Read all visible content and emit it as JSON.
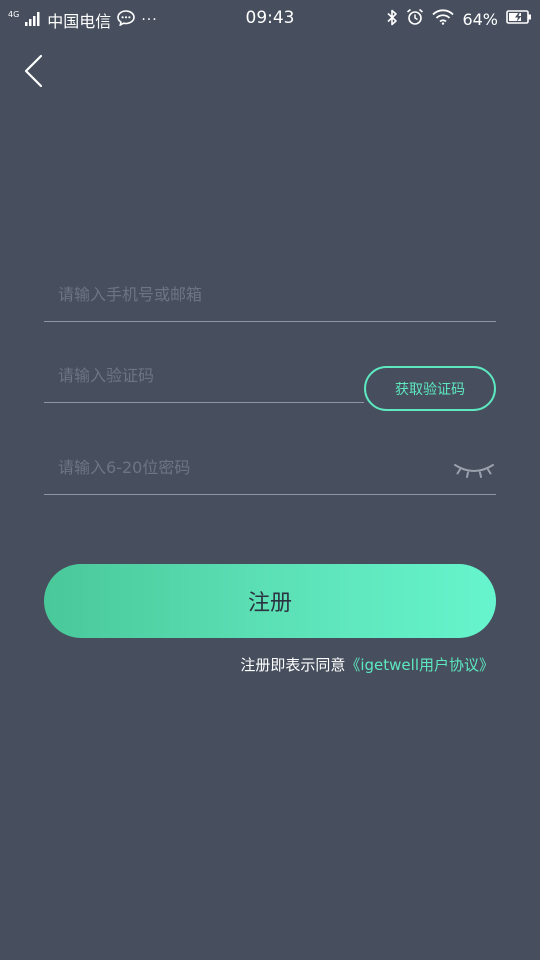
{
  "status_bar": {
    "network_tag": "4G",
    "carrier": "中国电信",
    "more": "···",
    "time": "09:43",
    "battery_percent": "64%",
    "icons": [
      "signal-icon",
      "chat-icon",
      "bluetooth-icon",
      "alarm-icon",
      "wifi-icon",
      "battery-charging-icon"
    ]
  },
  "form": {
    "phone": {
      "placeholder": "请输入手机号或邮箱",
      "value": ""
    },
    "code": {
      "placeholder": "请输入验证码",
      "value": "",
      "button_label": "获取验证码"
    },
    "password": {
      "placeholder": "请输入6-20位密码",
      "value": "",
      "toggle_icon": "eye-closed-icon"
    }
  },
  "register": {
    "label": "注册"
  },
  "agreement": {
    "prefix": "注册即表示同意",
    "link": "《igetwell用户协议》"
  },
  "colors": {
    "background": "#474f5e",
    "accent": "#5de8c0",
    "button_gradient_start": "#49c89a",
    "button_gradient_end": "#66f5cd"
  }
}
